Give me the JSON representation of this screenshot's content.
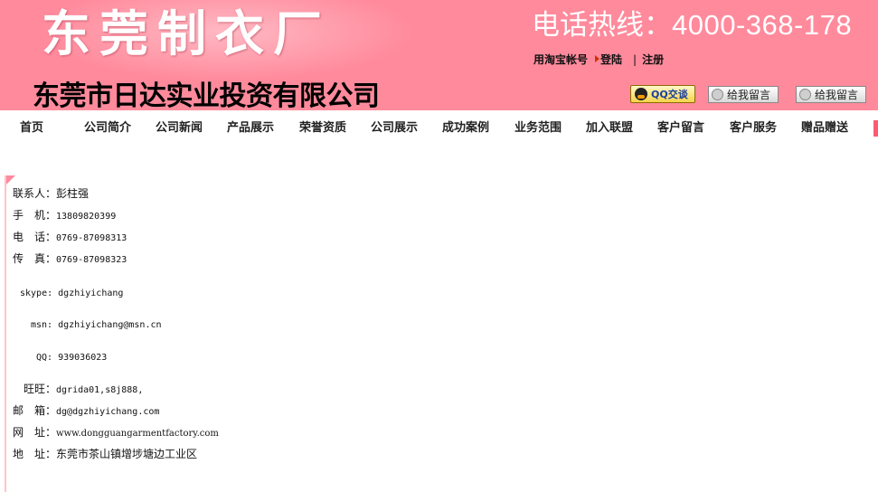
{
  "header": {
    "factory_title": "东莞制衣厂",
    "hotline_label": "电话热线：",
    "hotline_number": "4000-368-178",
    "account_links": {
      "taobao": "用淘宝帐号",
      "login": "登陆",
      "separator": "|",
      "register": "注册"
    },
    "company_name": "东莞市日达实业投资有限公司",
    "qq_button": "QQ交谈",
    "message_button_1": "给我留言",
    "message_button_2": "给我留言"
  },
  "nav": {
    "items": [
      "首页",
      "公司简介",
      "公司新闻",
      "产品展示",
      "荣誉资质",
      "公司展示",
      "成功案例",
      "业务范围",
      "加入联盟",
      "客户留言",
      "客户服务",
      "赠品赠送"
    ]
  },
  "contact": {
    "contact_person": {
      "label": "联系人：",
      "value": "彭柱强"
    },
    "mobile": {
      "label": "手　机：",
      "value": "13809820399"
    },
    "phone": {
      "label": "电　话：",
      "value": "0769-87098313"
    },
    "fax": {
      "label": "传　真：",
      "value": "0769-87098323"
    },
    "skype": {
      "label": "skype: ",
      "value": "dgzhiyichang"
    },
    "msn": {
      "label": "msn: ",
      "value": "dgzhiyichang@msn.cn"
    },
    "qq": {
      "label": "QQ: ",
      "value": "939036023"
    },
    "wangwang": {
      "label": "旺旺：",
      "value": "dgrida01,s8j888,"
    },
    "email": {
      "label": "邮　箱：",
      "value": "dg@dgzhiyichang.com"
    },
    "website": {
      "label": "网　址：",
      "value": "www.dongguangarmentfactory.com"
    },
    "address": {
      "label": "地　址：",
      "value": "东莞市茶山镇增埗塘边工业区"
    }
  },
  "colors": {
    "banner_pink": "#ff8a9c",
    "nav_accent": "#ff5a73"
  }
}
